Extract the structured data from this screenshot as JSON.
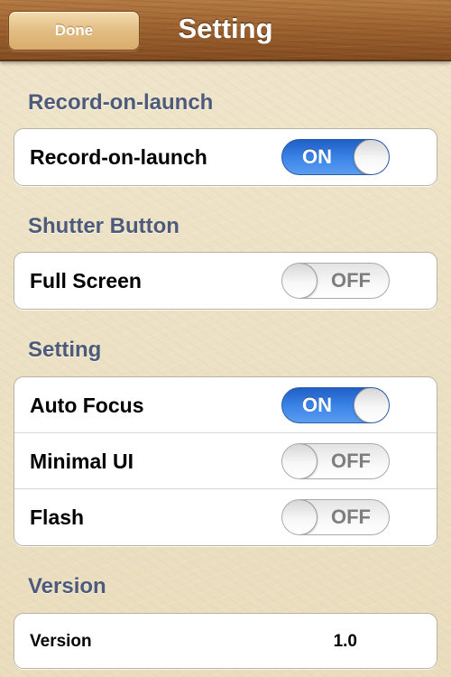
{
  "navbar": {
    "title": "Setting",
    "done_label": "Done"
  },
  "sections": {
    "record": {
      "header": "Record-on-launch",
      "row_label": "Record-on-launch",
      "switch_text": "ON"
    },
    "shutter": {
      "header": "Shutter Button",
      "row_label": "Full Screen",
      "switch_text": "OFF"
    },
    "setting": {
      "header": "Setting",
      "auto_focus_label": "Auto Focus",
      "auto_focus_switch": "ON",
      "minimal_ui_label": "Minimal UI",
      "minimal_ui_switch": "OFF",
      "flash_label": "Flash",
      "flash_switch": "OFF"
    },
    "version": {
      "header": "Version",
      "row_label": "Version",
      "value": "1.0"
    }
  },
  "colors": {
    "switch_on": "#3d86e8",
    "section_header": "#4e5a7a",
    "navbar_wood": "#9c612e"
  }
}
